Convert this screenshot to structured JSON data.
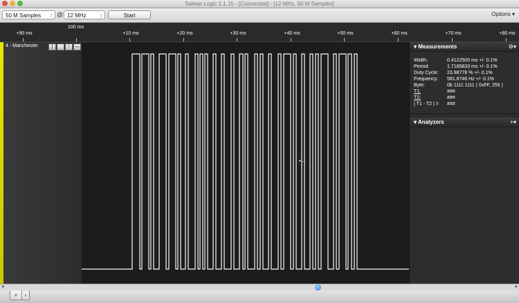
{
  "window": {
    "title": "Saleae Logic 1.1.15 - [Connected] - [12 MHz, 50 M Samples]",
    "buttons": [
      {
        "name": "close",
        "color": "#e2554c"
      },
      {
        "name": "minimize",
        "color": "#e3b33b"
      },
      {
        "name": "zoom",
        "color": "#57b643"
      }
    ]
  },
  "toolbar": {
    "samples_value": "50 M Samples",
    "at_sign": "@",
    "rate_value": "12 MHz",
    "start_label": "Start",
    "options_label": "Options ▾"
  },
  "ruler": {
    "reference_label": "100 ms",
    "ticks": [
      "+90 ms",
      "+10 ms",
      "+20 ms",
      "+30 ms",
      "+40 ms",
      "+50 ms",
      "+60 ms",
      "+70 ms",
      "+80 ms"
    ]
  },
  "channel": {
    "label": "4 - Manchester",
    "color": "#e6e600",
    "buttons": [
      "ʃ",
      "‾",
      "↑",
      "—"
    ]
  },
  "waveform": {
    "color": "#ffffff",
    "cursor_glyph": "•→"
  },
  "measurements": {
    "title": "Measurements",
    "gear": "⚙▾",
    "rows": [
      {
        "label": "Width:",
        "value": "0.4122500 ms +/- 0.1%"
      },
      {
        "label": "Period:",
        "value": "1.7185833 ms +/- 0.1%"
      },
      {
        "label": "Duty Cycle:",
        "value": "23.98778 % +/- 0.1%"
      },
      {
        "label": "Frequency:",
        "value": "581.8746 Hz +/- 0.1%"
      },
      {
        "label": "Byte:",
        "value": "0b  1111  1111 ( 0xFF, 255 )"
      },
      {
        "label": "T1:",
        "value": "###"
      },
      {
        "label": "T2:",
        "value": "###"
      },
      {
        "label": "| T1 - T2 | =",
        "value": "###"
      }
    ]
  },
  "analyzers": {
    "title": "Analyzers",
    "add": "+▾"
  },
  "scrollbar": {
    "left_arrow": "◂",
    "right_arrow": "▸"
  },
  "bottom_tabs": [
    "⌕",
    "›"
  ]
}
